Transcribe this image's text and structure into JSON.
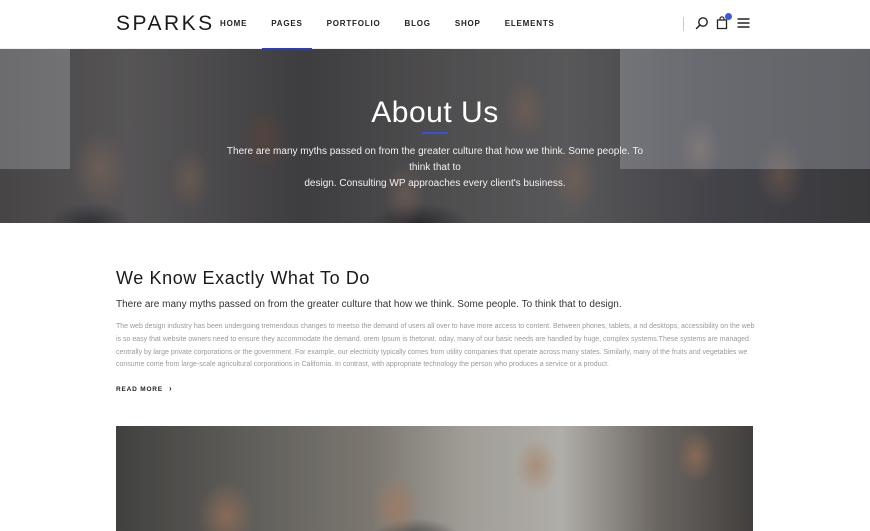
{
  "header": {
    "logo": "SPARKS",
    "nav": [
      "HOME",
      "PAGES",
      "PORTFOLIO",
      "BLOG",
      "SHOP",
      "ELEMENTS"
    ],
    "active_nav": "PAGES",
    "icons": [
      "search-icon",
      "cart-icon",
      "menu-icon"
    ],
    "accent": "#2a3dc4"
  },
  "hero": {
    "title": "About Us",
    "text_line1": "There are many myths passed on from the greater culture that how we think. Some people. To think that to",
    "text_line2": "design. Consulting WP approaches every client's business."
  },
  "intro": {
    "title": "We Know Exactly What To Do",
    "subtitle": "There are many myths passed on from the greater culture that  how we think. Some people. To think that to design.",
    "body": "The web design industry has been undergoing tremendous changes to meetso the demand of users all over to have more access to content. Between  phones, tablets, a nd desktops, accessibility on the web is so easy that website owners need to ensure they accommodate the demand. orem Ipsum is thetonat. oday, many of our basic needs are handled by huge, complex systems.These systems are managed centrally by large private corporations or the government. For example, our electricity typically comes from utility companies that operate across many states. Similarly, many of the fruits and vegetables we consume come from large-scale agricultural corporations in California. In contrast, with appropriate technology the person who produces a service or a product.",
    "read_more": "READ MORE"
  }
}
